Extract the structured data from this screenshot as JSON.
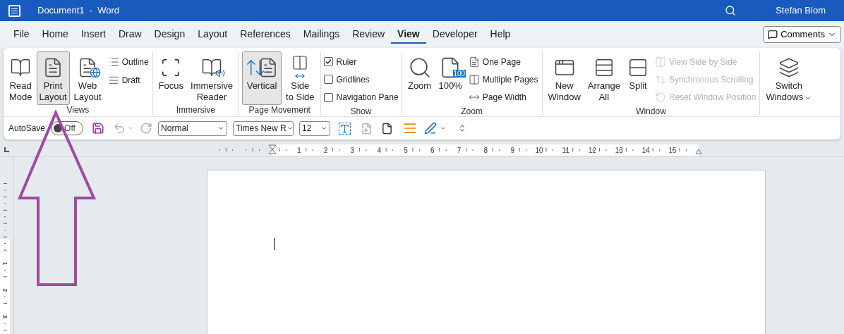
{
  "title_bar": {
    "title": "Document1  -  Word",
    "user": "Stefan Blom"
  },
  "menu_tabs": [
    {
      "label": "File",
      "selected": false
    },
    {
      "label": "Home",
      "selected": false
    },
    {
      "label": "Insert",
      "selected": false
    },
    {
      "label": "Draw",
      "selected": false
    },
    {
      "label": "Design",
      "selected": false
    },
    {
      "label": "Layout",
      "selected": false
    },
    {
      "label": "References",
      "selected": false
    },
    {
      "label": "Mailings",
      "selected": false
    },
    {
      "label": "Review",
      "selected": false
    },
    {
      "label": "View",
      "selected": true
    },
    {
      "label": "Developer",
      "selected": false
    },
    {
      "label": "Help",
      "selected": false
    }
  ],
  "comments_button": "Comments",
  "ribbon_groups": [
    {
      "label": "Views",
      "items": [
        {
          "kind": "large",
          "lines": [
            "Read",
            "Mode"
          ],
          "selected": false
        },
        {
          "kind": "large",
          "lines": [
            "Print",
            "Layout"
          ],
          "selected": true
        },
        {
          "kind": "large",
          "lines": [
            "Web",
            "Layout"
          ],
          "selected": false
        },
        {
          "kind": "stack",
          "items": [
            {
              "label": "Outline",
              "disabled": false
            },
            {
              "label": "Draft",
              "disabled": false
            }
          ]
        }
      ]
    },
    {
      "label": "Immersive",
      "items": [
        {
          "kind": "large",
          "lines": [
            "Focus"
          ],
          "selected": false
        },
        {
          "kind": "large",
          "lines": [
            "Immersive",
            "Reader"
          ],
          "selected": false
        }
      ]
    },
    {
      "label": "Page Movement",
      "items": [
        {
          "kind": "large",
          "lines": [
            "Vertical"
          ],
          "selected": true
        },
        {
          "kind": "large",
          "lines": [
            "Side",
            "to Side"
          ],
          "selected": false
        }
      ]
    },
    {
      "label": "Show",
      "items": [
        {
          "kind": "checks",
          "items": [
            {
              "label": "Ruler",
              "checked": true
            },
            {
              "label": "Gridlines",
              "checked": false
            },
            {
              "label": "Navigation Pane",
              "checked": false
            }
          ]
        }
      ]
    },
    {
      "label": "Zoom",
      "items": [
        {
          "kind": "large",
          "lines": [
            "Zoom"
          ],
          "selected": false
        },
        {
          "kind": "large",
          "lines": [
            "100%"
          ],
          "badge": "100",
          "selected": false
        },
        {
          "kind": "stack",
          "items": [
            {
              "label": "One Page",
              "disabled": false
            },
            {
              "label": "Multiple Pages",
              "disabled": false
            },
            {
              "label": "Page Width",
              "disabled": false
            }
          ]
        }
      ]
    },
    {
      "label": "Window",
      "items": [
        {
          "kind": "large",
          "lines": [
            "New",
            "Window"
          ],
          "selected": false
        },
        {
          "kind": "large",
          "lines": [
            "Arrange",
            "All"
          ],
          "selected": false
        },
        {
          "kind": "large",
          "lines": [
            "Split"
          ],
          "selected": false
        },
        {
          "kind": "stack",
          "items": [
            {
              "label": "View Side by Side",
              "disabled": true
            },
            {
              "label": "Synchronous Scrolling",
              "disabled": true
            },
            {
              "label": "Reset Window Position",
              "disabled": true
            }
          ]
        }
      ]
    },
    {
      "items": [
        {
          "kind": "large",
          "lines": [
            "Switch",
            "Windows"
          ],
          "dropdown": true,
          "selected": false
        }
      ]
    }
  ],
  "quick_access": {
    "autosave_label": "AutoSave",
    "autosave_state": "Off",
    "autosave_on": false,
    "style": "Normal",
    "font": "Times New R",
    "size": "12"
  },
  "ruler": {
    "h_numbers": [
      "1",
      "2",
      "3",
      "4",
      "5",
      "6",
      "7",
      "8",
      "9",
      "10",
      "11",
      "12",
      "13",
      "14",
      "15"
    ],
    "v_numbers": [
      "1",
      "2",
      "3"
    ]
  }
}
